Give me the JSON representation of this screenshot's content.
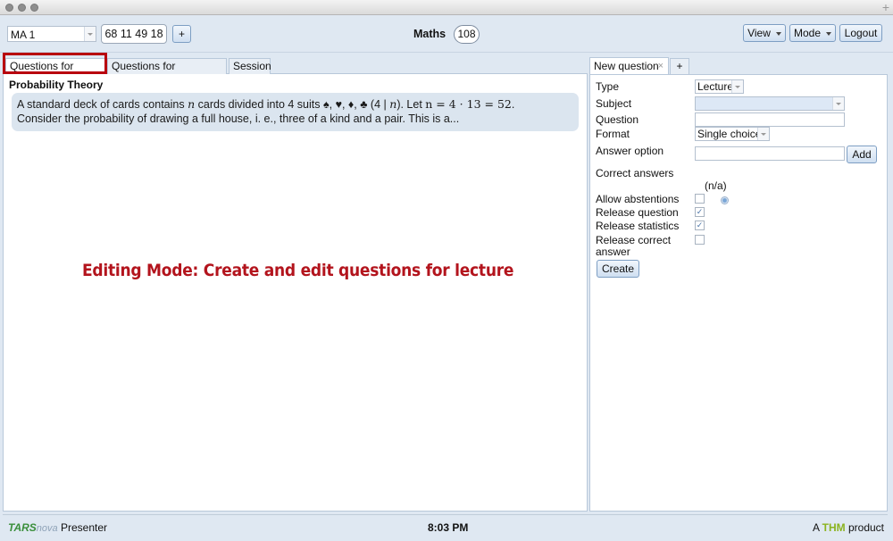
{
  "topbar": {
    "course_select": "MA 1",
    "session_key": "68 11 49 18",
    "add_label": "+",
    "course_title": "Maths",
    "online_count": "108",
    "view_label": "View",
    "mode_label": "Mode",
    "logout_label": "Logout"
  },
  "left": {
    "tabs": [
      "Questions for lecture",
      "Questions for preparation",
      "Session"
    ],
    "section_title": "Probability Theory",
    "question": {
      "line1_a": "A standard deck of cards contains ",
      "var_n": "n",
      "line1_b": " cards divided into 4 suits ♠, ♥, ♦, ♣ (4 | ",
      "line1_c": "). Let ",
      "eq": "n = 4 · 13 = 52",
      "line1_d": ".",
      "line2": "Consider the probability of drawing a full house, i. e., three of a kind and a pair. This is a..."
    },
    "annotation": "Editing Mode: Create and edit questions for lecture"
  },
  "right": {
    "tab_label": "New question",
    "tab_close": "×",
    "tab_add": "+",
    "type_label": "Type",
    "type_value": "Lecture",
    "subject_label": "Subject",
    "subject_value": "",
    "question_label": "Question",
    "question_value": "",
    "format_label": "Format",
    "format_value": "Single choice",
    "answer_option_label": "Answer option",
    "answer_option_value": "",
    "add_button": "Add",
    "correct_answers_label": "Correct answers",
    "correct_answers_value": "(n/a)",
    "allow_abstentions_label": "Allow abstentions",
    "release_question_label": "Release question",
    "release_statistics_label": "Release statistics",
    "release_correct_label_1": "Release correct",
    "release_correct_label_2": "answer",
    "create_button": "Create",
    "checks": {
      "allow_abstentions": false,
      "release_question": true,
      "release_statistics": true,
      "release_correct": false
    }
  },
  "status": {
    "logo_tars": "TARS",
    "logo_nova": "nova",
    "logo_suffix": " Presenter",
    "time": "8:03 PM",
    "brand_prefix": "A ",
    "brand_name": "THM",
    "brand_suffix": " product"
  }
}
